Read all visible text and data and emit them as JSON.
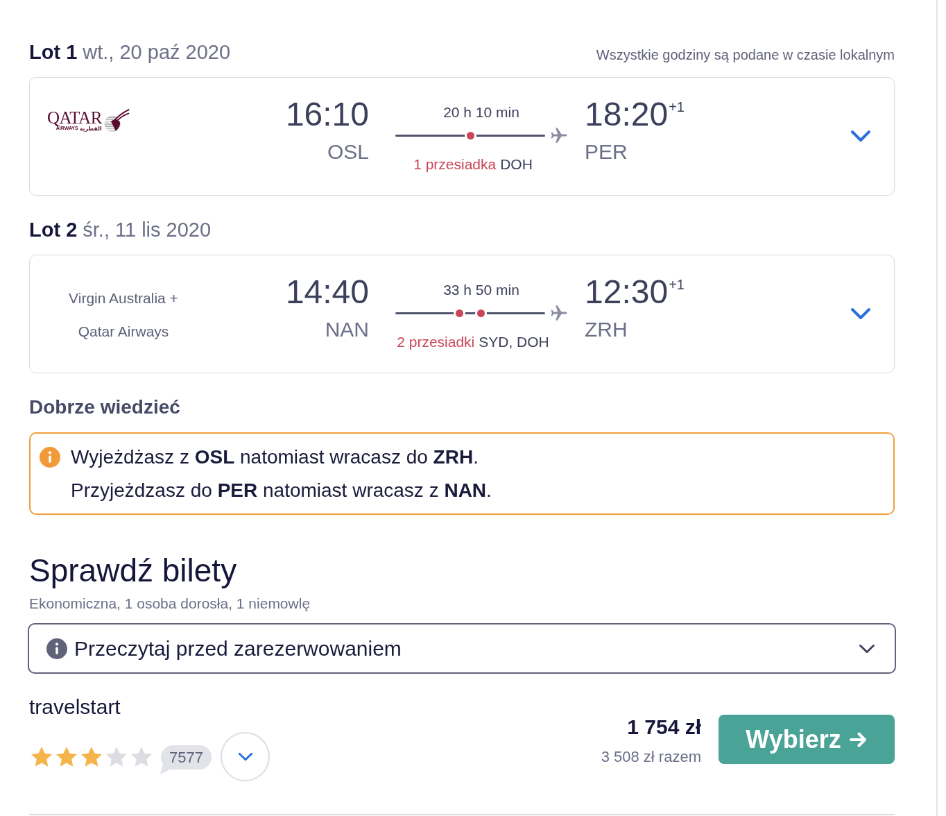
{
  "time_note": "Wszystkie godziny są podane w czasie lokalnym",
  "flights": [
    {
      "label": "Lot 1",
      "date": "wt., 20 paź 2020",
      "airline": {
        "kind": "logo",
        "wordmark": "QATAR",
        "subline": "AIRWAYS",
        "subline_arabic": "القطرية"
      },
      "departure": {
        "time": "16:10",
        "airport": "OSL"
      },
      "duration": "20 h 10 min",
      "stops_label": "1 przesiadka",
      "stop_airports": "DOH",
      "stop_dots": [
        {
          "kind": "stop"
        }
      ],
      "arrival": {
        "time": "18:20",
        "day_offset": "+1",
        "airport": "PER"
      },
      "expanded": false
    },
    {
      "label": "Lot 2",
      "date": "śr., 11 lis 2020",
      "airline": {
        "kind": "text",
        "name": "Virgin Australia + Qatar Airways"
      },
      "departure": {
        "time": "14:40",
        "airport": "NAN"
      },
      "duration": "33 h 50 min",
      "stops_label": "2 przesiadki",
      "stop_airports": "SYD, DOH",
      "stop_dots": [
        {
          "kind": "stop"
        },
        {
          "kind": "stop"
        }
      ],
      "arrival": {
        "time": "12:30",
        "day_offset": "+1",
        "airport": "ZRH"
      },
      "expanded": false
    }
  ],
  "good_to_know": {
    "title": "Dobrze wiedzieć",
    "lines": [
      "Wyjeżdżasz z **OSL** natomiast wracasz do **ZRH**.",
      "Przyjeżdzasz do **PER** natomiast wracasz z **NAN**."
    ]
  },
  "tickets": {
    "title": "Sprawdź bilety",
    "subtitle": "Ekonomiczna, 1 osoba dorosła, 1 niemowlę",
    "notice": {
      "label": "Przeczytaj przed zarezerwowaniem",
      "expanded": false
    },
    "offers": [
      {
        "provider": "travelstart",
        "stars": 3,
        "review_count": "7577",
        "expanded": false,
        "price": "1 754 zł",
        "total": "3 508 zł razem",
        "button": "Wybierz"
      }
    ]
  }
}
